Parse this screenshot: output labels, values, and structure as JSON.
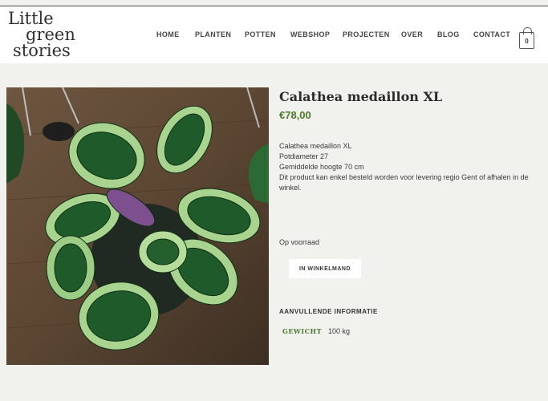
{
  "brand": {
    "logo_line1": "Little",
    "logo_line2": "green",
    "logo_line3": "stories"
  },
  "nav": {
    "items": [
      {
        "label": "HOME"
      },
      {
        "label": "PLANTEN"
      },
      {
        "label": "POTTEN"
      },
      {
        "label": "WEBSHOP"
      },
      {
        "label": "PROJECTEN"
      },
      {
        "label": "OVER"
      },
      {
        "label": "BLOG"
      },
      {
        "label": "CONTACT"
      }
    ]
  },
  "cart": {
    "count": "0"
  },
  "product": {
    "title": "Calathea medaillon XL",
    "price": "€78,00",
    "description": [
      "Calathea medaillon XL",
      "Potdiameter 27",
      "Gemiddelde hoogte 70 cm",
      "Dit product kan enkel besteld worden voor levering regio Gent of afhalen in de winkel."
    ],
    "stock_status": "Op voorraad",
    "add_to_cart_label": "IN WINKELMAND",
    "additional_info_title": "AANVULLENDE INFORMATIE",
    "weight_label": "GEWICHT",
    "weight_value": "100 kg"
  },
  "colors": {
    "accent_green": "#4b7a2c",
    "background": "#f1f1ee"
  }
}
